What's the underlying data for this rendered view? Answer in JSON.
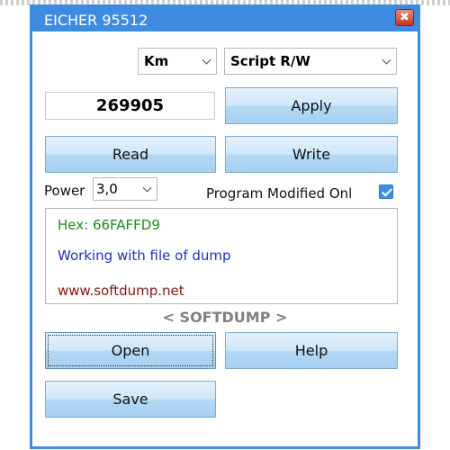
{
  "window": {
    "title": "EICHER 95512",
    "close_glyph": "✖"
  },
  "controls": {
    "unit_select": "Km",
    "mode_select": "Script R/W",
    "value_input": "269905",
    "apply_label": "Apply",
    "read_label": "Read",
    "write_label": "Write",
    "power_label": "Power",
    "power_value": "3,0",
    "program_modified_label": "Program Modified Onl",
    "program_modified_checked": true
  },
  "info": {
    "hex_line": "Hex: 66FAFFD9",
    "status_line": "Working with file of dump",
    "website": "www.softdump.net",
    "hex_color": "#1a8a1a",
    "status_color": "#1f2fc9",
    "website_color": "#8b1414"
  },
  "brand": "< SOFTDUMP >",
  "footer_buttons": {
    "open_label": "Open",
    "help_label": "Help",
    "save_label": "Save"
  },
  "colors": {
    "title_bar": "#3e8ce2",
    "close_button": "#d44a33",
    "button_fill": "#b3d8f3"
  }
}
